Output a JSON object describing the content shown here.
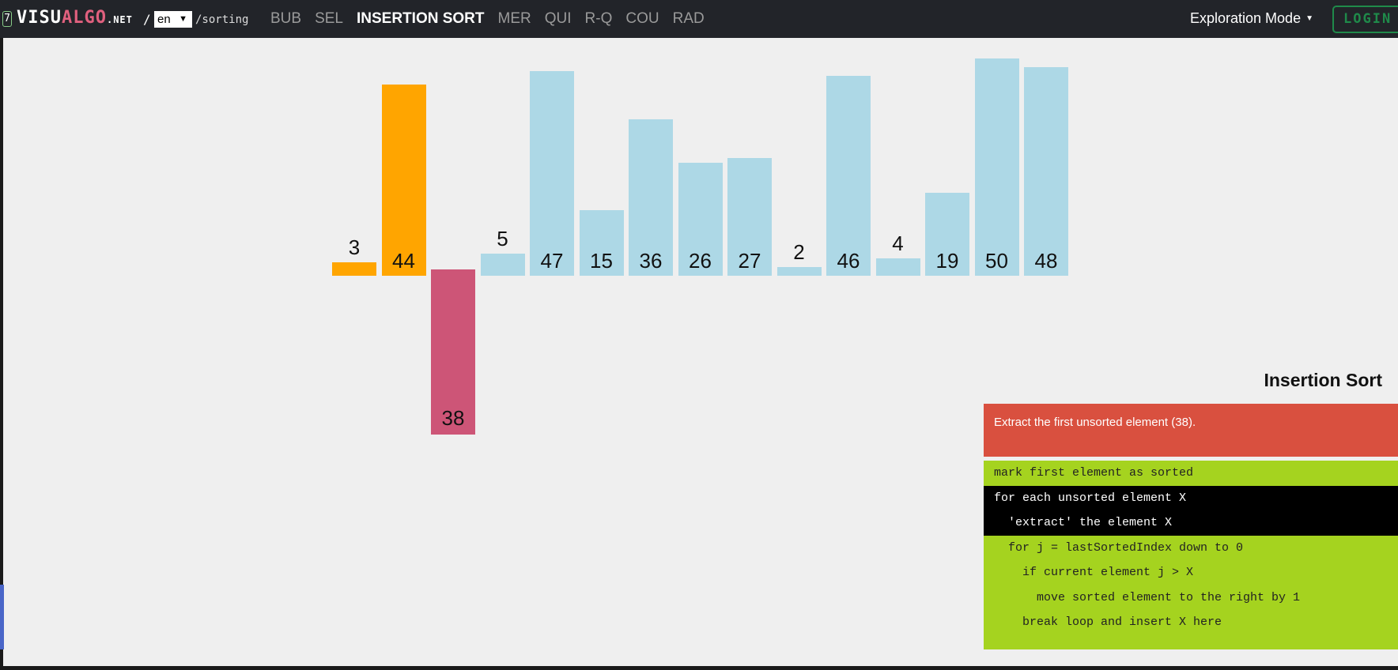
{
  "topbar": {
    "badge": "7",
    "logo_part1": "VISU",
    "logo_part2": "ALGO",
    "logo_part3": ".NET",
    "separator": "/",
    "language": "en",
    "path": "/sorting",
    "nav": [
      {
        "label": "BUB",
        "active": false
      },
      {
        "label": "SEL",
        "active": false
      },
      {
        "label": "INSERTION SORT",
        "active": true
      },
      {
        "label": "MER",
        "active": false
      },
      {
        "label": "QUI",
        "active": false
      },
      {
        "label": "R-Q",
        "active": false
      },
      {
        "label": "COU",
        "active": false
      },
      {
        "label": "RAD",
        "active": false
      }
    ],
    "mode": "Exploration Mode",
    "login": "LOGIN"
  },
  "array": {
    "values": [
      3,
      44,
      38,
      5,
      47,
      15,
      36,
      26,
      27,
      2,
      46,
      4,
      19,
      50,
      48
    ],
    "states": [
      "sorted",
      "sorted",
      "extracted",
      "unsorted",
      "unsorted",
      "unsorted",
      "unsorted",
      "unsorted",
      "unsorted",
      "unsorted",
      "unsorted",
      "unsorted",
      "unsorted",
      "unsorted",
      "unsorted"
    ],
    "max_value": 50
  },
  "colors": {
    "sorted": "#ffa500",
    "extracted": "#cd5577",
    "unsorted": "#add8e6",
    "status_bg": "#d9503f",
    "code_bg": "#a5d31f",
    "code_highlight": "#000000"
  },
  "panel": {
    "title": "Insertion Sort",
    "status": "Extract the first unsorted element (38).",
    "code": [
      {
        "text": "mark first element as sorted",
        "highlight": false
      },
      {
        "text": "for each unsorted element X",
        "highlight": true
      },
      {
        "text": "  'extract' the element X",
        "highlight": true
      },
      {
        "text": "  for j = lastSortedIndex down to 0",
        "highlight": false
      },
      {
        "text": "    if current element j > X",
        "highlight": false
      },
      {
        "text": "      move sorted element to the right by 1",
        "highlight": false
      },
      {
        "text": "    break loop and insert X here",
        "highlight": false
      }
    ]
  }
}
